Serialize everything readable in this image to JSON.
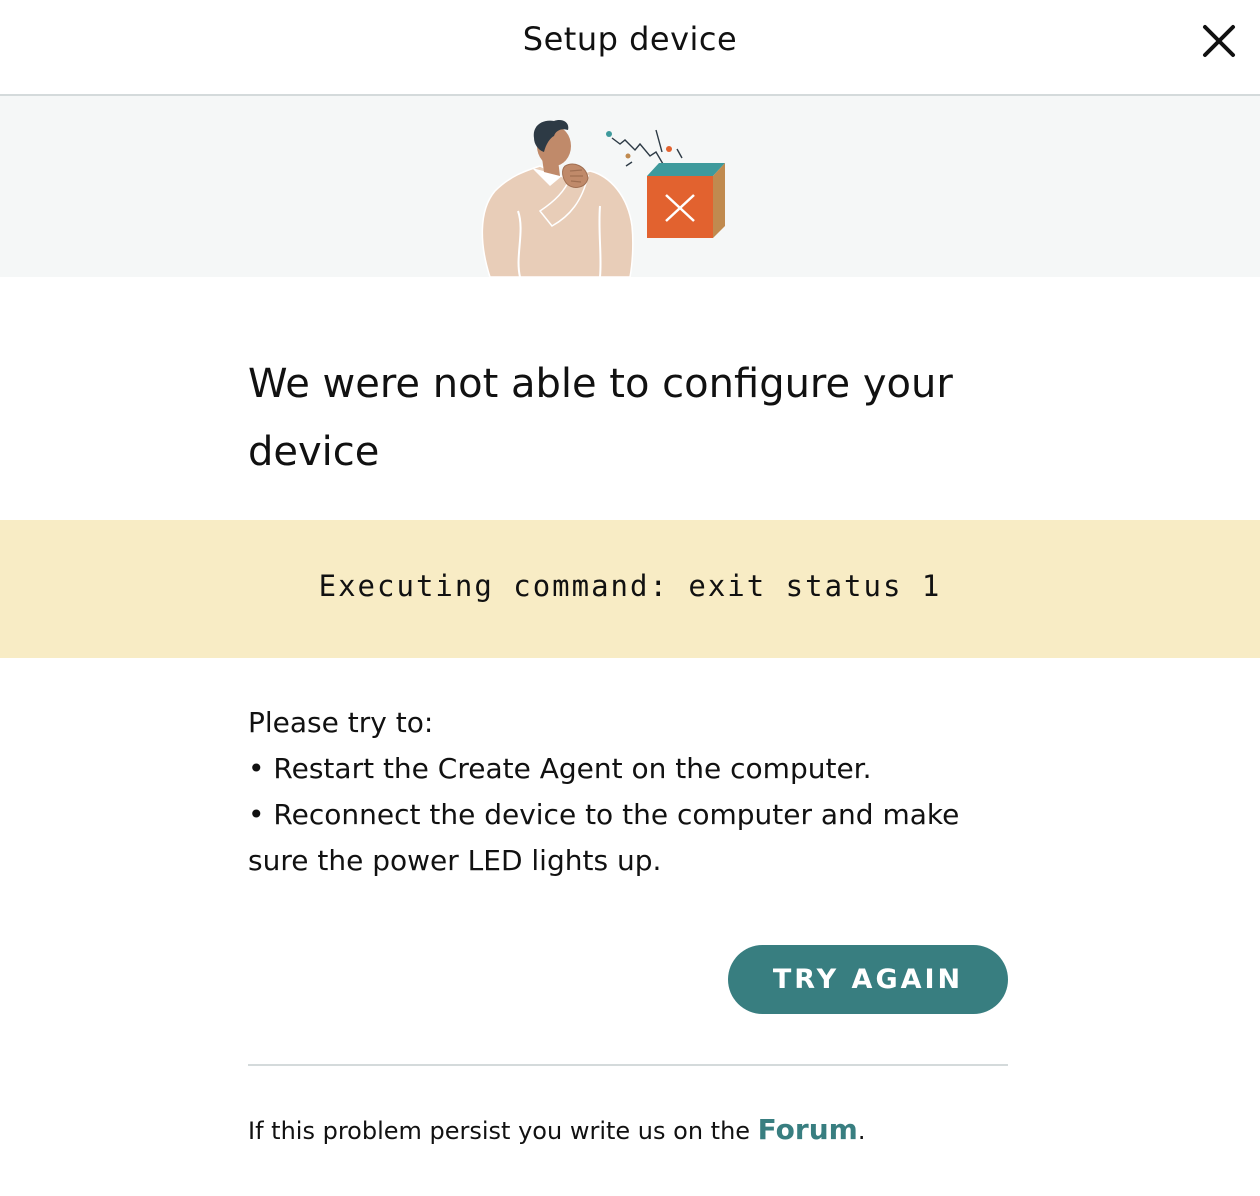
{
  "header": {
    "title": "Setup device",
    "close_icon": "close-icon"
  },
  "illustration": {
    "icon": "confused-person-error-box-illustration",
    "colors": {
      "skin": "#c08a6a",
      "sweater": "#e8cdb8",
      "hair": "#2d3a45",
      "box_front": "#e2622f",
      "box_side": "#c08a4f",
      "box_top": "#3e9a9c"
    }
  },
  "error": {
    "title": "We were not able to configure your device",
    "code": "Executing command: exit status 1"
  },
  "suggestions": {
    "intro": "Please try to:",
    "items": [
      "• Restart the Create Agent on the computer.",
      "• Reconnect the device to the computer and make sure the power LED lights up."
    ]
  },
  "actions": {
    "try_again_label": "TRY AGAIN"
  },
  "footer": {
    "text_before": "If this problem persist you write us on the ",
    "link_label": "Forum",
    "text_after": "."
  },
  "colors": {
    "accent": "#387e80",
    "error_band": "#f8ecc5",
    "illustration_band": "#f5f7f7",
    "divider": "#d4dadb"
  }
}
